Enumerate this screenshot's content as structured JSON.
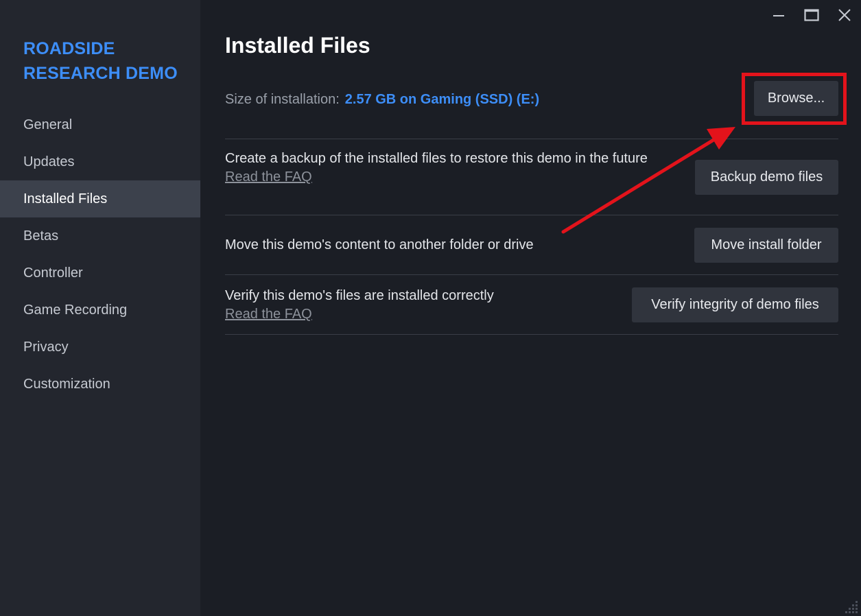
{
  "sidebar": {
    "game_title": "ROADSIDE RESEARCH DEMO",
    "items": [
      {
        "label": "General"
      },
      {
        "label": "Updates"
      },
      {
        "label": "Installed Files",
        "active": true
      },
      {
        "label": "Betas"
      },
      {
        "label": "Controller"
      },
      {
        "label": "Game Recording"
      },
      {
        "label": "Privacy"
      },
      {
        "label": "Customization"
      }
    ]
  },
  "header": {
    "title": "Installed Files"
  },
  "window_controls": [
    "minimize-icon",
    "maximize-icon",
    "close-icon"
  ],
  "installation": {
    "size_label": "Size of installation:",
    "size_value": "2.57 GB on Gaming (SSD) (E:)",
    "browse_label": "Browse..."
  },
  "rows": [
    {
      "text": "Create a backup of the installed files to restore this demo in the future",
      "link": "Read the FAQ",
      "button": "Backup demo files"
    },
    {
      "text": "Move this demo's content to another folder or drive",
      "button": "Move install folder"
    },
    {
      "text": "Verify this demo's files are installed correctly",
      "link": "Read the FAQ",
      "button": "Verify integrity of demo files"
    }
  ],
  "colors": {
    "accent": "#3d8ef8",
    "annotation": "#e3131b",
    "background": "#1b1e25",
    "sidebar": "#23262e",
    "button": "#30343d"
  }
}
